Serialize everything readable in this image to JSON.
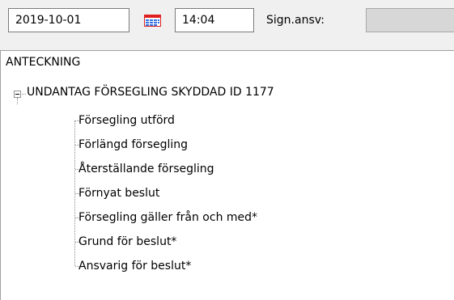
{
  "toolbar": {
    "date": "2019-10-01",
    "time": "14:04",
    "sign_label": "Sign.ansv:",
    "sign_value": ""
  },
  "tree": {
    "root": "ANTECKNING",
    "parent": "UNDANTAG FÖRSEGLING SKYDDAD ID 1177",
    "children": [
      "Försegling utförd",
      "Förlängd försegling",
      "Återställande försegling",
      "Förnyat beslut",
      "Försegling gäller från och med*",
      "Grund för beslut*",
      "Ansvarig för beslut*"
    ]
  },
  "colors": {
    "calendar_icon_red": "#e02020",
    "calendar_icon_blue": "#2f6fe0",
    "disabled_field": "#d7d7d7"
  }
}
